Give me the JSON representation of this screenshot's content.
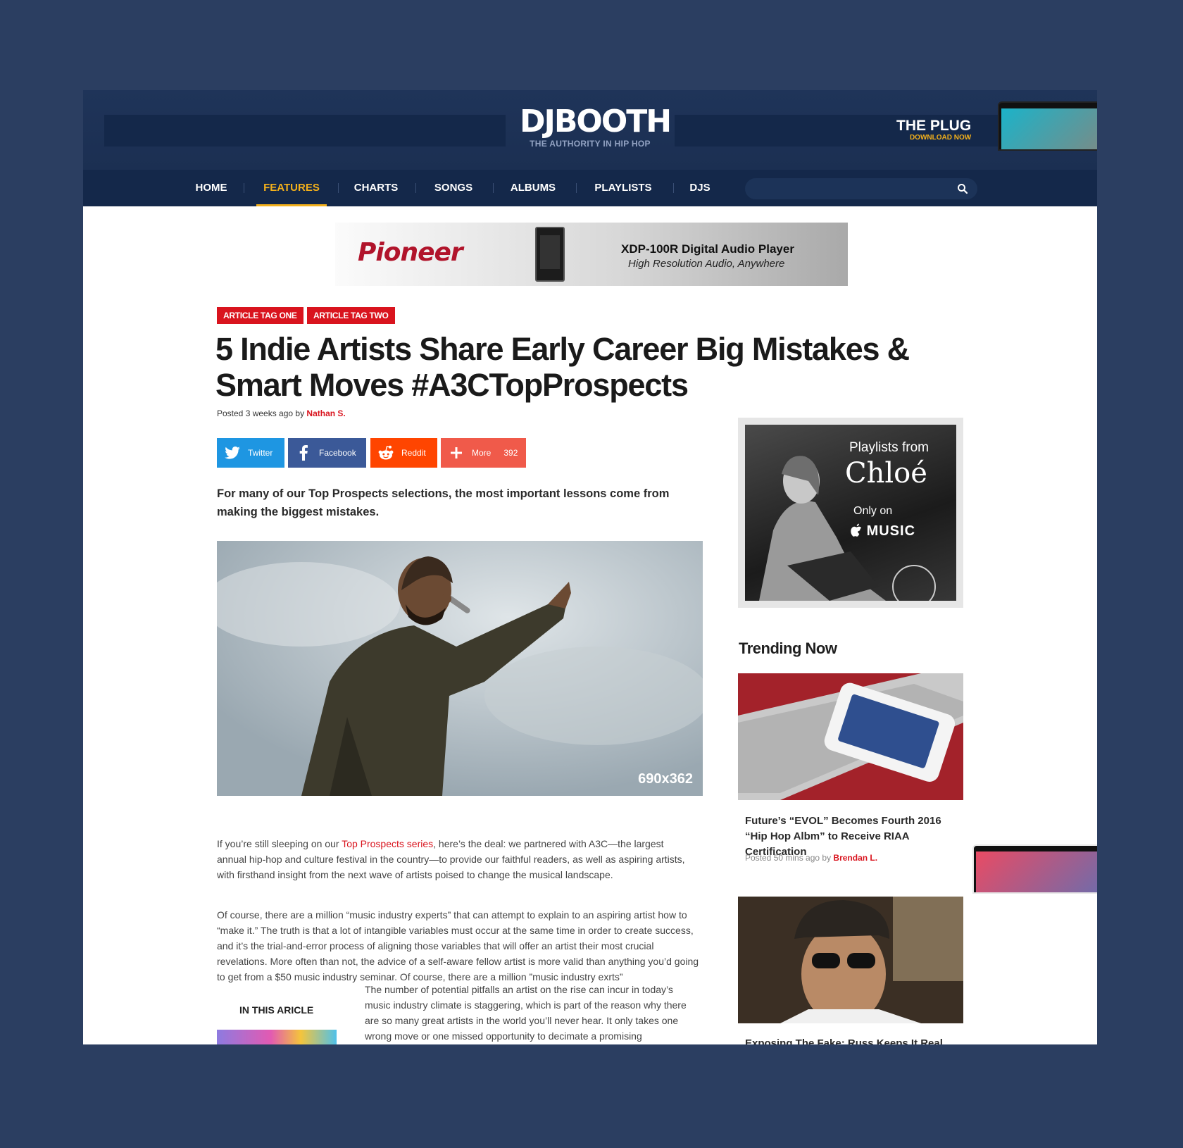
{
  "brand": {
    "logo": "DJBOOTH",
    "tagline": "THE AUTHORITY IN HIP HOP",
    "promo_title": "THE PLUG",
    "promo_sub": "DOWNLOAD NOW",
    "accent": "#f3b01b",
    "red": "#d9141e",
    "navy": "#1f3459"
  },
  "nav": {
    "items": [
      "HOME",
      "FEATURES",
      "CHARTS",
      "SONGS",
      "ALBUMS",
      "PLAYLISTS",
      "DJS"
    ],
    "active": "FEATURES",
    "search_placeholder": "",
    "search_icon": "search-icon"
  },
  "ad": {
    "brand": "Pioneer",
    "title": "XDP-100R Digital Audio Player",
    "subtitle": "High Resolution Audio, Anywhere"
  },
  "article": {
    "tags": [
      "ARTICLE TAG ONE",
      "ARTICLE TAG TWO"
    ],
    "headline": "5 Indie Artists Share Early Career Big Mistakes & Smart Moves #A3CTopProspects",
    "byline_prefix": "Posted 3 weeks ago by",
    "author": "Nathan S.",
    "share": {
      "twitter": "Twitter",
      "facebook": "Facebook",
      "reddit": "Reddit",
      "more": "More",
      "count": "392"
    },
    "lede": "For many of our Top Prospects selections, the most important lessons come from making the biggest mistakes.",
    "hero_label": "690x362",
    "p1_before": "If you’re still sleeping on our ",
    "p1_link": "Top Prospects series",
    "p1_after": ", here’s the deal: we partnered with A3C—the largest annual hip-hop and culture festival in the country—to provide our faithful readers, as well as aspiring artists, with firsthand insight from the next wave of artists poised to change the musical landscape.",
    "p2": "Of course, there are a million “music industry experts” that can attempt to explain to an aspiring artist how to “make it.” The truth is that a lot of intangible variables must occur at the same time in order to create success, and it’s the trial-and-error process of aligning those variables that will offer an artist their most crucial revelations. More often than not, the advice of a self-aware fellow artist is more valid than anything you’d going to get from a $50 music industry seminar. Of course, there are a million ”music industry exrts”",
    "p3": "The number of potential pitfalls an artist on the rise can incur in today’s music industry climate is staggering, which is part of the reason why there are so many great artists in the world you’ll never hear. It only takes one wrong move or one missed opportunity to decimate a promising",
    "in_article": "IN THIS ARICLE"
  },
  "sidebar": {
    "ad": {
      "line1": "Playlists from",
      "line2": "Chloé",
      "line3": "Only on",
      "line4": "MUSIC"
    },
    "trending_heading": "Trending Now",
    "items": [
      {
        "title": "Future’s “EVOL” Becomes Fourth 2016 “Hip Hop Albm” to Receive RIAA Certification",
        "meta_prefix": "Posted 50 mins ago by",
        "author": "Brendan L."
      },
      {
        "title": "Exposing The Fake: Russ Keeps It Real About"
      }
    ]
  }
}
